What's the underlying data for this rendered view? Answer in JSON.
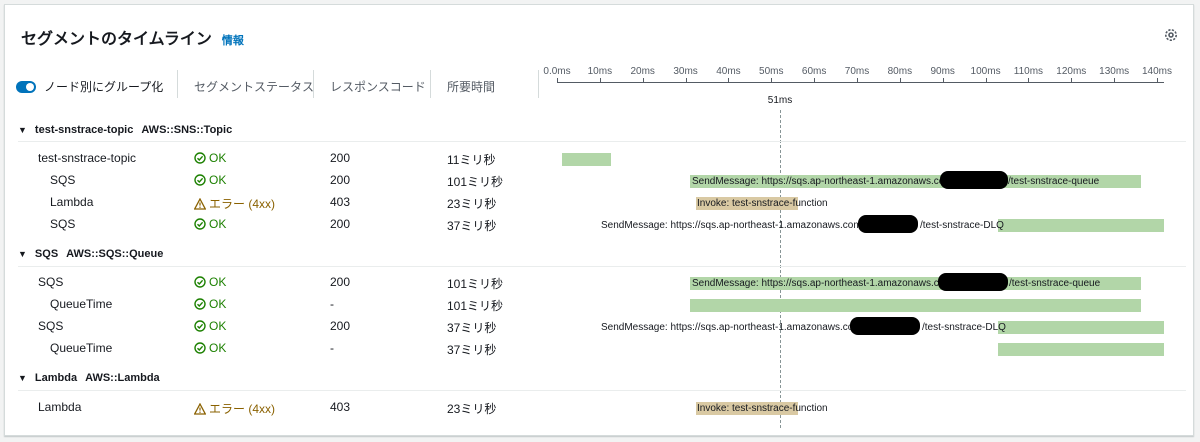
{
  "panel": {
    "title": "セグメントのタイムライン",
    "info_link": "情報"
  },
  "toggle": {
    "label": "ノード別にグループ化"
  },
  "columns": {
    "status": "セグメントステータス",
    "response": "レスポンスコード",
    "duration": "所要時間"
  },
  "axis": {
    "unit": "ms",
    "ticks": [
      "0.0ms",
      "10ms",
      "20ms",
      "30ms",
      "40ms",
      "50ms",
      "60ms",
      "70ms",
      "80ms",
      "90ms",
      "100ms",
      "110ms",
      "120ms",
      "130ms",
      "140ms"
    ],
    "marker_label": "51ms"
  },
  "groups": [
    {
      "name": "test-snstrace-topic",
      "type": "AWS::SNS::Topic"
    },
    {
      "name": "SQS",
      "type": "AWS::SQS::Queue"
    },
    {
      "name": "Lambda",
      "type": "AWS::Lambda"
    }
  ],
  "rows": [
    {
      "name": "test-snstrace-topic",
      "status": "OK",
      "code": "200",
      "duration": "11ミリ秒",
      "bar_label": ""
    },
    {
      "name": "SQS",
      "status": "OK",
      "code": "200",
      "duration": "101ミリ秒",
      "bar_label": "SendMessage: https://sqs.ap-northeast-1.amazonaws.com/",
      "bar_label_tail": "/test-snstrace-queue"
    },
    {
      "name": "Lambda",
      "status": "エラー (4xx)",
      "code": "403",
      "duration": "23ミリ秒",
      "bar_label": "Invoke: test-snstrace-function"
    },
    {
      "name": "SQS",
      "status": "OK",
      "code": "200",
      "duration": "37ミリ秒",
      "bar_label": "SendMessage: https://sqs.ap-northeast-1.amazonaws.com,",
      "bar_label_tail": "/test-snstrace-DLQ"
    },
    {
      "name": "SQS",
      "status": "OK",
      "code": "200",
      "duration": "101ミリ秒",
      "bar_label": "SendMessage: https://sqs.ap-northeast-1.amazonaws.com",
      "bar_label_tail": "/test-snstrace-queue"
    },
    {
      "name": "QueueTime",
      "status": "OK",
      "code": "-",
      "duration": "101ミリ秒",
      "bar_label": ""
    },
    {
      "name": "SQS",
      "status": "OK",
      "code": "200",
      "duration": "37ミリ秒",
      "bar_label": "SendMessage: https://sqs.ap-northeast-1.amazonaws.com,",
      "bar_label_tail": "/test-snstrace-DLQ"
    },
    {
      "name": "QueueTime",
      "status": "OK",
      "code": "-",
      "duration": "37ミリ秒",
      "bar_label": ""
    },
    {
      "name": "Lambda",
      "status": "エラー (4xx)",
      "code": "403",
      "duration": "23ミリ秒",
      "bar_label": "Invoke: test-snstrace-function"
    }
  ],
  "colors": {
    "ok": "#1d8102",
    "error": "#8a6100",
    "bar_ok": "#b2d6a8",
    "bar_error": "#d9c9a3",
    "link": "#0073bb"
  }
}
